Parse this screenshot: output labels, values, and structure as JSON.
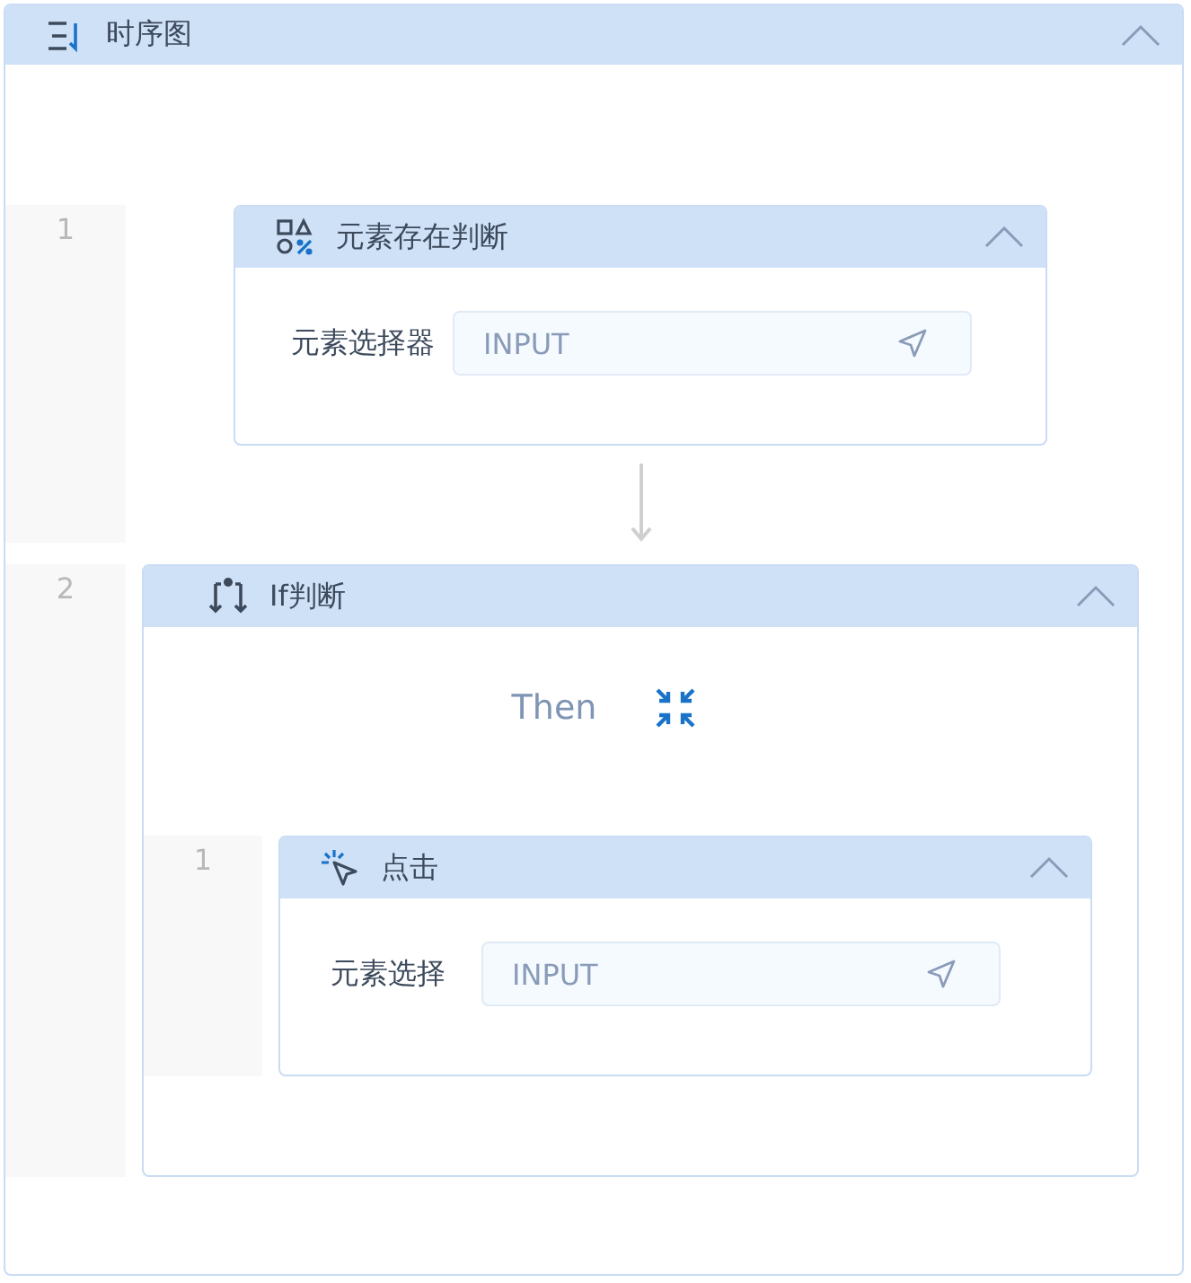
{
  "panel": {
    "title": "时序图",
    "expanded": true,
    "steps": [
      {
        "number": "1",
        "kind": "exists",
        "title": "元素存在判断",
        "expanded": true,
        "field": {
          "label": "元素选择器",
          "placeholder": "INPUT"
        }
      },
      {
        "number": "2",
        "kind": "if",
        "title": "If判断",
        "expanded": true,
        "branch": {
          "label": "Then",
          "expanded": true,
          "steps": [
            {
              "number": "1",
              "kind": "click",
              "title": "点击",
              "expanded": true,
              "field": {
                "label": "元素选择",
                "placeholder": "INPUT"
              }
            }
          ]
        }
      }
    ]
  }
}
